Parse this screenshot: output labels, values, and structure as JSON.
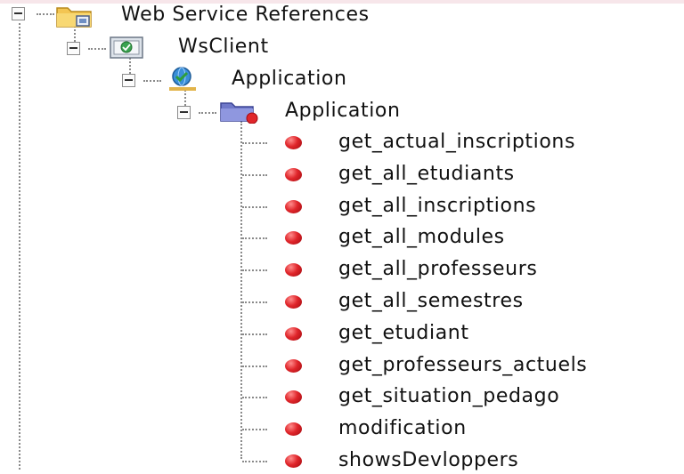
{
  "tree": {
    "root": {
      "label": "Web Service References",
      "icon": "folder-icon"
    },
    "client": {
      "label": "WsClient",
      "icon": "web-service-client-icon"
    },
    "service": {
      "label": "Application",
      "icon": "web-service-icon"
    },
    "port": {
      "label": "Application",
      "icon": "port-folder-icon"
    },
    "operations": [
      "get_actual_inscriptions",
      "get_all_etudiants",
      "get_all_inscriptions",
      "get_all_modules",
      "get_all_professeurs",
      "get_all_semestres",
      "get_etudiant",
      "get_professeurs_actuels",
      "get_situation_pedago",
      "modification",
      "showsDevloppers"
    ],
    "operation_icon": "operation-bullet-icon",
    "colors": {
      "connector": "#8a8a8a",
      "operation_bullet": "#e0262b",
      "folder": "#f3c552",
      "service_globe": "#3a8fd8",
      "service_check": "#2e9e3a"
    }
  }
}
